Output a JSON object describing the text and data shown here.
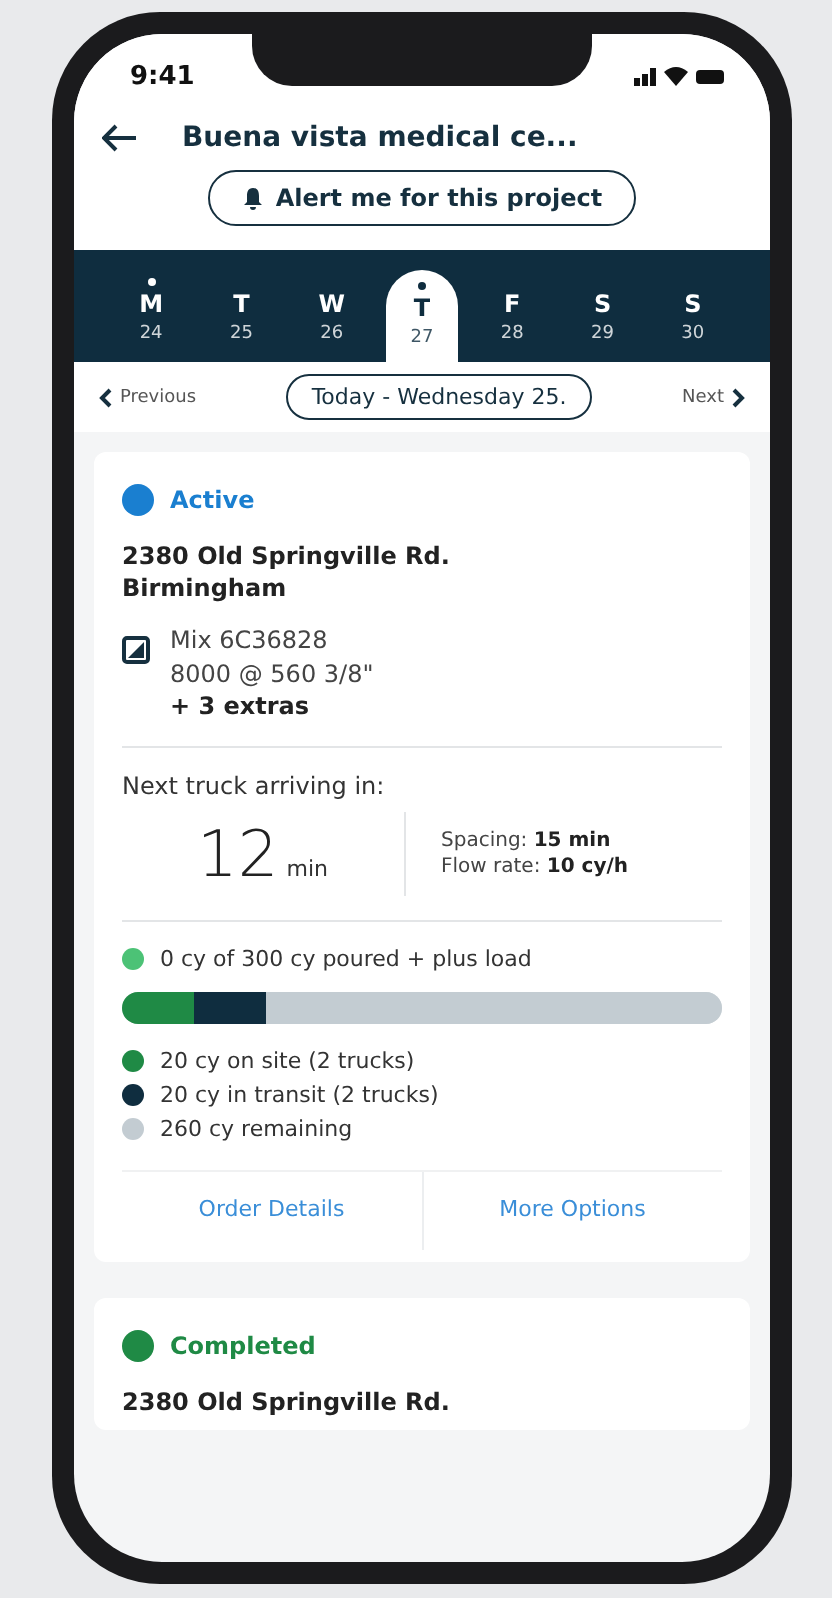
{
  "status_bar": {
    "time": "9:41"
  },
  "header": {
    "title": "Buena vista medical ce...",
    "alert_button": "Alert me for this project"
  },
  "days": [
    {
      "letter": "M",
      "date": "24",
      "selected": false,
      "has_event": true
    },
    {
      "letter": "T",
      "date": "25",
      "selected": false,
      "has_event": false
    },
    {
      "letter": "W",
      "date": "26",
      "selected": false,
      "has_event": false
    },
    {
      "letter": "T",
      "date": "27",
      "selected": true,
      "has_event": true
    },
    {
      "letter": "F",
      "date": "28",
      "selected": false,
      "has_event": false
    },
    {
      "letter": "S",
      "date": "29",
      "selected": false,
      "has_event": false
    },
    {
      "letter": "S",
      "date": "30",
      "selected": false,
      "has_event": false
    }
  ],
  "date_nav": {
    "previous": "Previous",
    "current": "Today - Wednesday 25.",
    "next": "Next"
  },
  "orders": [
    {
      "status": "Active",
      "color": "#1a7fd0",
      "address": [
        "2380 Old Springville Rd.",
        "Birmingham"
      ],
      "mix": [
        "Mix 6C36828",
        "8000 @ 560 3/8\""
      ],
      "extras": "+ 3 extras",
      "next_truck_label": "Next truck arriving in:",
      "eta_value": "12",
      "eta_unit": "min",
      "spacing_label": "Spacing:",
      "spacing_value": "15 min",
      "flow_label": "Flow rate:",
      "flow_value": "10 cy/h",
      "poured": {
        "text": "0 cy of 300 cy poured + plus load",
        "color": "#4cc276"
      },
      "segments": [
        {
          "label": "20 cy on site (2 trucks)",
          "color": "#1f8a45",
          "level": 0.12
        },
        {
          "label": "20 cy in transit (2 trucks)",
          "color": "#0f2d3f",
          "level": 0.12
        },
        {
          "label": "260 cy remaining",
          "color": "#c3ccd2",
          "level": 0.76
        }
      ],
      "actions": [
        "Order Details",
        "More Options"
      ]
    },
    {
      "status": "Completed",
      "color": "#1f8a45",
      "address": [
        "2380 Old Springville Rd."
      ]
    }
  ]
}
